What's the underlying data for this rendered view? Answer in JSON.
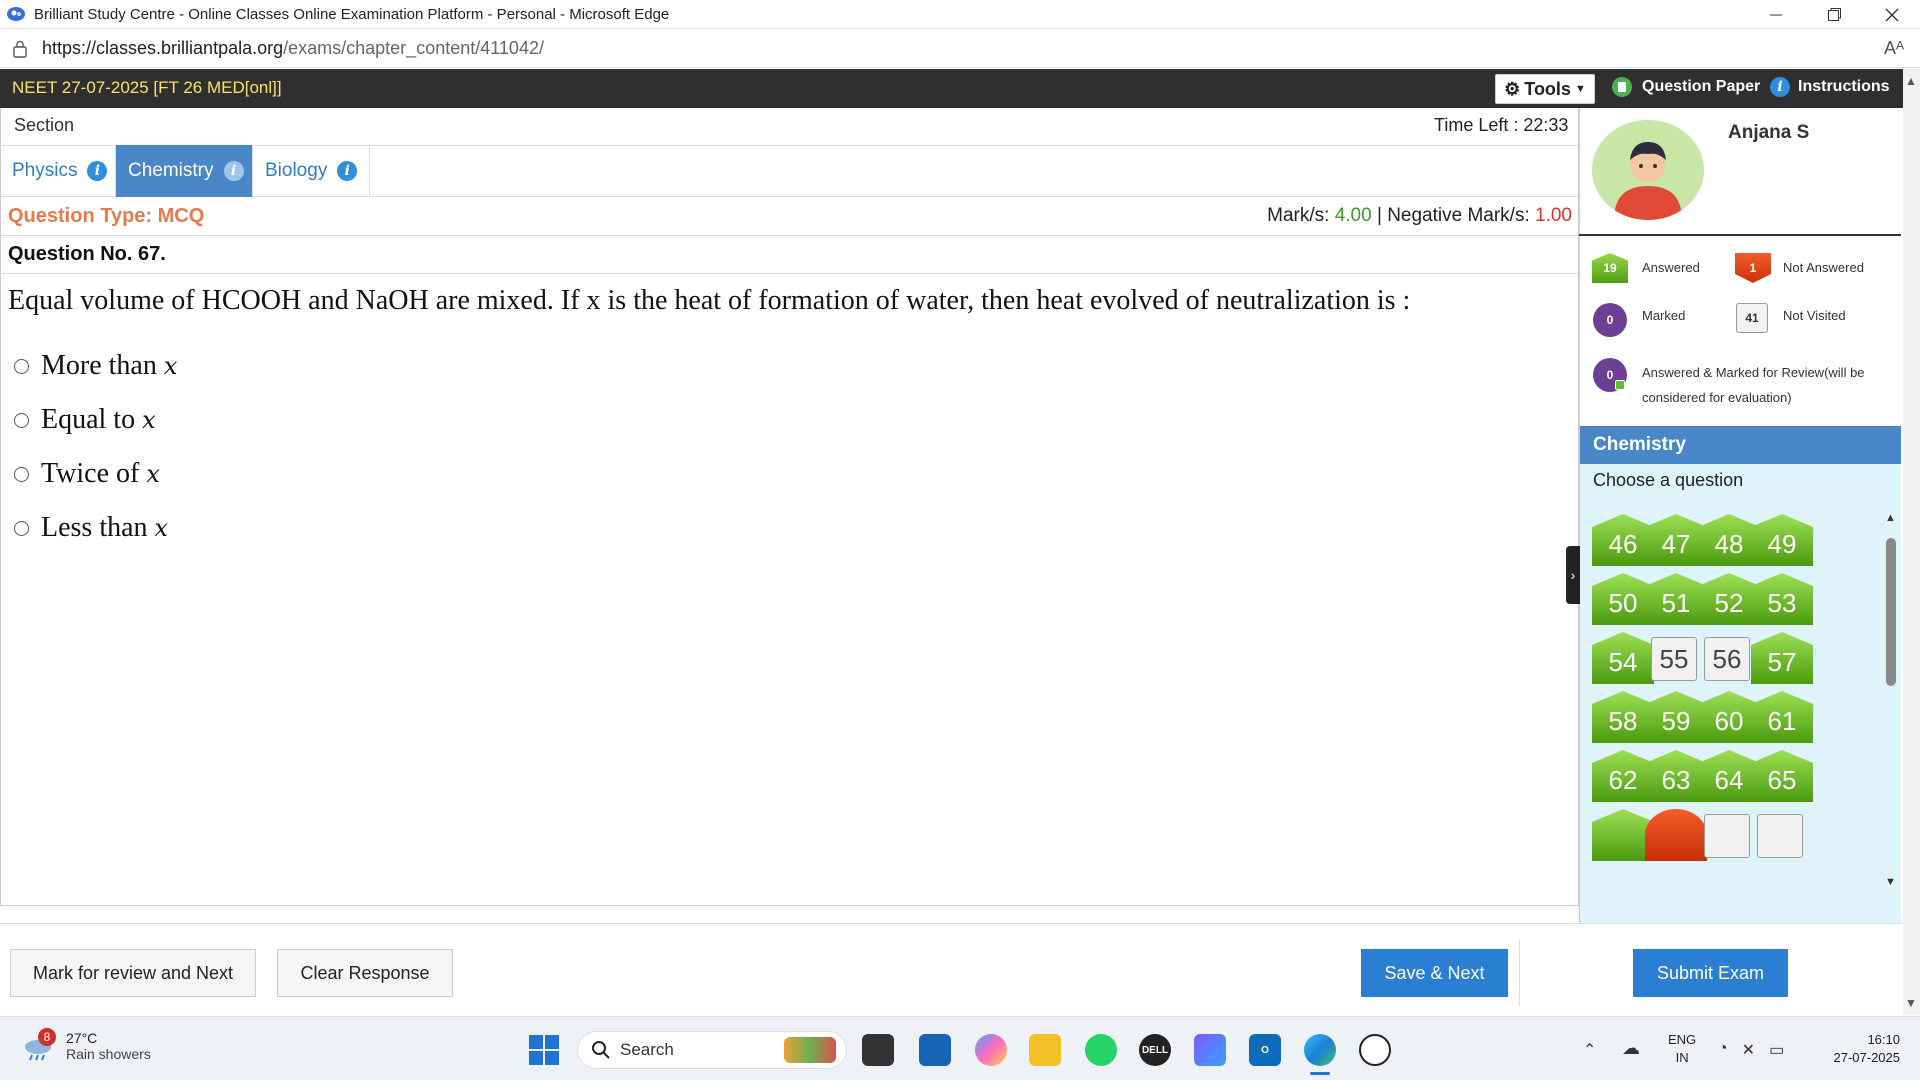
{
  "browser": {
    "window_title": "Brilliant Study Centre - Online Classes Online Examination Platform - Personal - Microsoft Edge",
    "url_host": "https://classes.brilliantpala.org",
    "url_path": "/exams/chapter_content/411042/",
    "readaloud": "Aᴬ"
  },
  "exam": {
    "title": "NEET 27-07-2025 [FT 26 MED[onl]]",
    "tools_label": "Tools",
    "question_paper_label": "Question Paper",
    "instructions_label": "Instructions",
    "section_label": "Section",
    "time_left_label": "Time Left :",
    "time_left_value": "22:33"
  },
  "tabs": [
    {
      "label": "Physics",
      "active": false
    },
    {
      "label": "Chemistry",
      "active": true
    },
    {
      "label": "Biology",
      "active": false
    }
  ],
  "question": {
    "type_label": "Question Type: MCQ",
    "marks_label": "Mark/s:",
    "marks_value": "4.00",
    "separator": "|",
    "negative_label": "Negative Mark/s:",
    "negative_value": "1.00",
    "number_label": "Question No. 67.",
    "text": "Equal volume of HCOOH and NaOH are mixed. If x is the heat of formation of water, then heat evolved of neutralization is :",
    "options": [
      {
        "text": "More than ",
        "var": "x"
      },
      {
        "text": "Equal to ",
        "var": "x"
      },
      {
        "text": "Twice of ",
        "var": "x"
      },
      {
        "text": "Less than ",
        "var": "x"
      }
    ]
  },
  "user": {
    "name": "Anjana S"
  },
  "legend": {
    "answered_count": "19",
    "answered_label": "Answered",
    "not_answered_count": "1",
    "not_answered_label": "Not Answered",
    "marked_count": "0",
    "marked_label": "Marked",
    "not_visited_count": "41",
    "not_visited_label": "Not Visited",
    "ans_marked_count": "0",
    "ans_marked_label": "Answered & Marked for Review(will be considered for evaluation)"
  },
  "palette": {
    "subject": "Chemistry",
    "choose_label": "Choose a question",
    "questions": [
      {
        "n": "46",
        "s": "ans"
      },
      {
        "n": "47",
        "s": "ans"
      },
      {
        "n": "48",
        "s": "ans"
      },
      {
        "n": "49",
        "s": "ans"
      },
      {
        "n": "50",
        "s": "ans"
      },
      {
        "n": "51",
        "s": "ans"
      },
      {
        "n": "52",
        "s": "ans"
      },
      {
        "n": "53",
        "s": "ans"
      },
      {
        "n": "54",
        "s": "ans"
      },
      {
        "n": "55",
        "s": "nv"
      },
      {
        "n": "56",
        "s": "nv"
      },
      {
        "n": "57",
        "s": "ans"
      },
      {
        "n": "58",
        "s": "ans"
      },
      {
        "n": "59",
        "s": "ans"
      },
      {
        "n": "60",
        "s": "ans"
      },
      {
        "n": "61",
        "s": "ans"
      },
      {
        "n": "62",
        "s": "ans"
      },
      {
        "n": "63",
        "s": "ans"
      },
      {
        "n": "64",
        "s": "ans"
      },
      {
        "n": "65",
        "s": "ans"
      },
      {
        "n": "",
        "s": "ans"
      },
      {
        "n": "",
        "s": "na"
      },
      {
        "n": "",
        "s": "nv"
      },
      {
        "n": "",
        "s": "nv"
      }
    ]
  },
  "actions": {
    "mark_review": "Mark for review and Next",
    "clear": "Clear Response",
    "save_next": "Save & Next",
    "submit": "Submit Exam"
  },
  "taskbar": {
    "weather_badge": "8",
    "temperature": "27°C",
    "weather_desc": "Rain showers",
    "search_placeholder": "Search",
    "lang_line1": "ENG",
    "lang_line2": "IN",
    "time": "16:10",
    "date": "27-07-2025"
  }
}
